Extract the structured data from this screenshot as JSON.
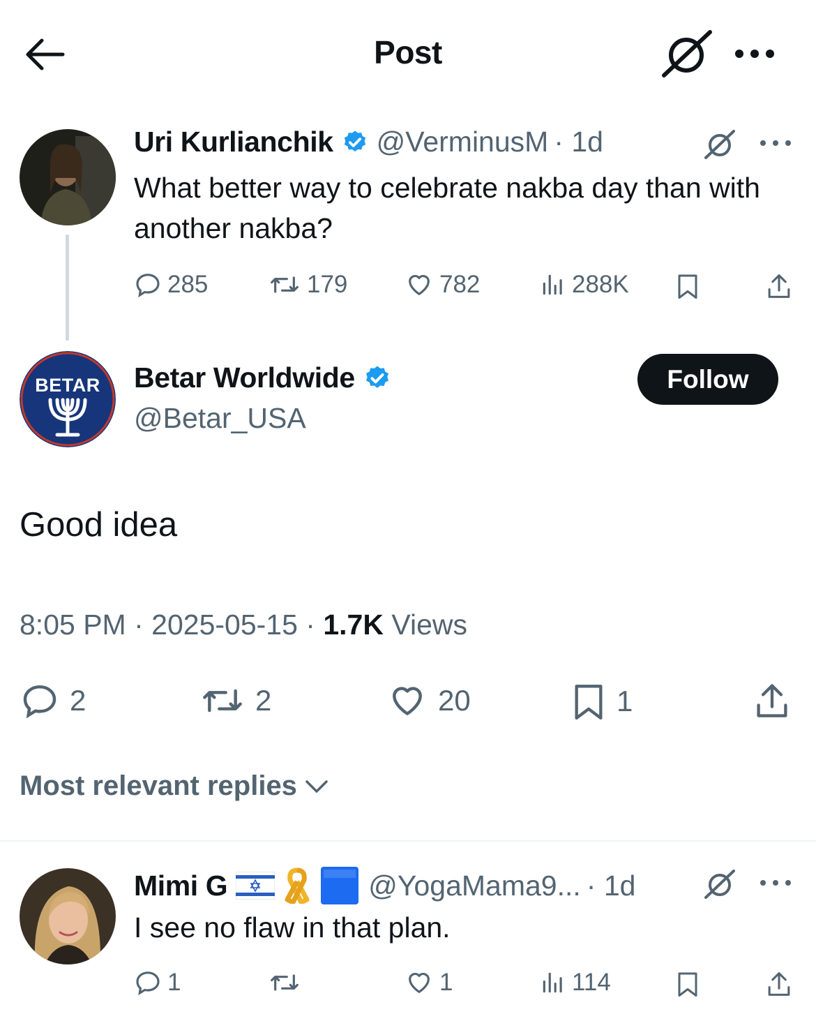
{
  "header": {
    "title": "Post",
    "back_icon": "arrow-left-icon",
    "grok_icon": "grok-icon",
    "more_icon": "more-icon"
  },
  "parent_post": {
    "name": "Uri Kurlianchik",
    "handle": "@VerminusM",
    "time": "· 1d",
    "text": "What better way to celebrate nakba day than with another nakba?",
    "stats": {
      "replies": "285",
      "reposts": "179",
      "likes": "782",
      "views": "288K"
    }
  },
  "main_post": {
    "name": "Betar Worldwide",
    "handle": "@Betar_USA",
    "avatar_text": "BETAR",
    "follow_label": "Follow",
    "text": "Good idea",
    "time": "8:05 PM",
    "date": "2025-05-15",
    "views_count": "1.7K",
    "views_label": "Views",
    "stats": {
      "replies": "2",
      "reposts": "2",
      "likes": "20",
      "bookmarks": "1"
    }
  },
  "replies_sort": {
    "label": "Most relevant replies"
  },
  "reply": {
    "name": "Mimi G",
    "handle": "@YogaMama9...",
    "time": "· 1d",
    "text": "I see no flaw in that plan.",
    "stats": {
      "replies": "1",
      "reposts": "",
      "likes": "1",
      "views": "114"
    }
  },
  "colors": {
    "text": "#0f1419",
    "secondary": "#536471",
    "verified": "#1d9bf0",
    "follow_bg": "#0f1419",
    "divider": "#eff3f4"
  }
}
